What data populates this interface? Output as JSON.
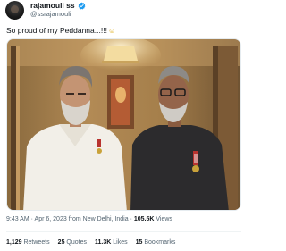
{
  "tweet": {
    "display_name": "rajamouli ss",
    "handle": "@ssrajamouli",
    "verified": true,
    "text": "So proud of my Peddanna...!!!",
    "emoji": "hugging-face-emoji",
    "time": "9:43 AM",
    "date": "Apr 6, 2023",
    "location": "from New Delhi, India",
    "views_count": "105.5K",
    "views_label": "Views",
    "stats": [
      {
        "count": "1,129",
        "label": "Retweets"
      },
      {
        "count": "25",
        "label": "Quotes"
      },
      {
        "count": "11.3K",
        "label": "Likes"
      },
      {
        "count": "15",
        "label": "Bookmarks"
      }
    ]
  },
  "colors": {
    "verified_blue": "#1d9bf0",
    "text_primary": "#0f1419",
    "text_secondary": "#536471"
  }
}
